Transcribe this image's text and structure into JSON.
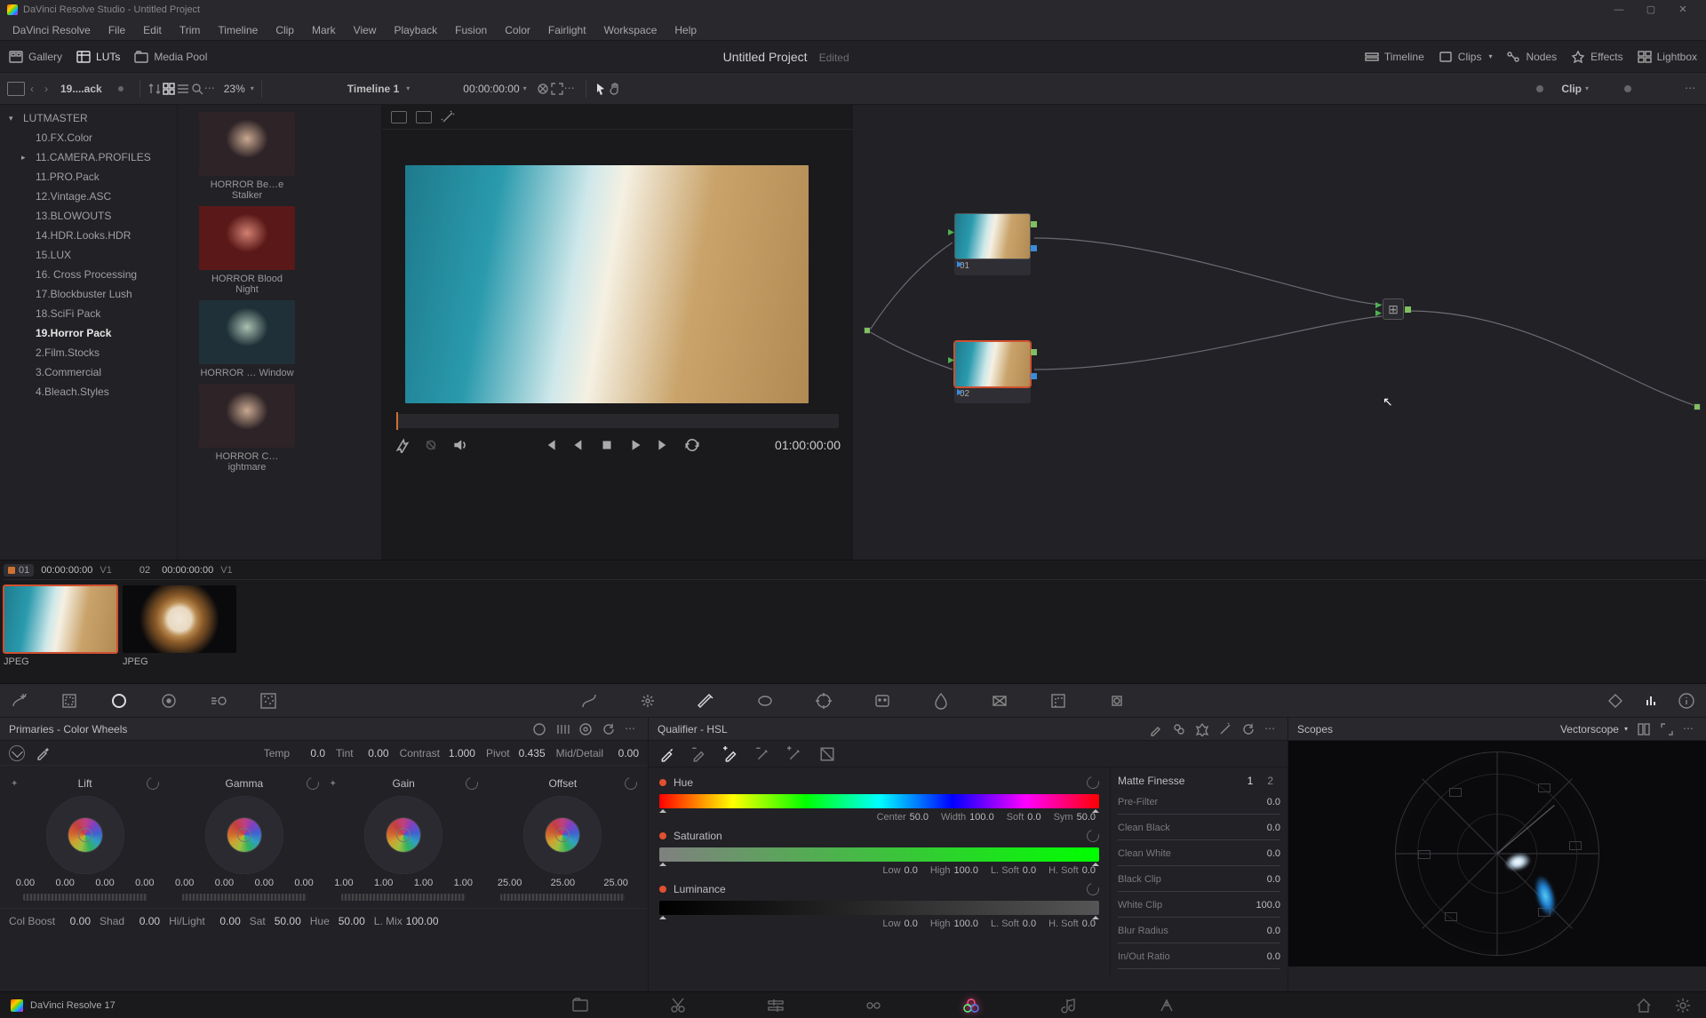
{
  "titlebar": {
    "text": "DaVinci Resolve Studio - Untitled Project"
  },
  "menu": [
    "DaVinci Resolve",
    "File",
    "Edit",
    "Trim",
    "Timeline",
    "Clip",
    "Mark",
    "View",
    "Playback",
    "Fusion",
    "Color",
    "Fairlight",
    "Workspace",
    "Help"
  ],
  "toptoolbar": {
    "gallery": "Gallery",
    "luts": "LUTs",
    "mediapool": "Media Pool",
    "project": "Untitled Project",
    "edited": "Edited",
    "timeline": "Timeline",
    "clips": "Clips",
    "nodes": "Nodes",
    "effects": "Effects",
    "lightbox": "Lightbox"
  },
  "subheader": {
    "crumb": "19....ack",
    "zoom": "23%",
    "timeline": "Timeline 1",
    "tc_small": "00:00:00:00",
    "clip": "Clip"
  },
  "lut_tree": {
    "root": "LUTMASTER",
    "items": [
      "10.FX.Color",
      "11.CAMERA.PROFILES",
      "11.PRO.Pack",
      "12.Vintage.ASC",
      "13.BLOWOUTS",
      "14.HDR.Looks.HDR",
      "15.LUX",
      "16. Cross Processing",
      "17.Blockbuster Lush",
      "18.SciFi Pack",
      "19.Horror Pack",
      "2.Film.Stocks",
      "3.Commercial",
      "4.Bleach.Styles"
    ],
    "selected_index": 10,
    "collapsed_index": 1
  },
  "lut_thumbs": [
    "HORROR Be…e Stalker",
    "HORROR Blood Night",
    "HORROR … Window",
    "HORROR C…ightmare"
  ],
  "viewer": {
    "tc": "01:00:00:00"
  },
  "nodes": {
    "n1": "01",
    "n2": "02"
  },
  "clips": {
    "h1": {
      "num": "01",
      "tc": "00:00:00:00",
      "track": "V1"
    },
    "h2": {
      "num": "02",
      "tc": "00:00:00:00",
      "track": "V1"
    },
    "label": "JPEG"
  },
  "primaries": {
    "title": "Primaries - Color Wheels",
    "row1": {
      "temp_l": "Temp",
      "temp": "0.0",
      "tint_l": "Tint",
      "tint": "0.00",
      "contrast_l": "Contrast",
      "contrast": "1.000",
      "pivot_l": "Pivot",
      "pivot": "0.435",
      "md_l": "Mid/Detail",
      "md": "0.00"
    },
    "wheels": {
      "lift": {
        "name": "Lift",
        "v": [
          "0.00",
          "0.00",
          "0.00",
          "0.00"
        ]
      },
      "gamma": {
        "name": "Gamma",
        "v": [
          "0.00",
          "0.00",
          "0.00",
          "0.00"
        ]
      },
      "gain": {
        "name": "Gain",
        "v": [
          "1.00",
          "1.00",
          "1.00",
          "1.00"
        ]
      },
      "offset": {
        "name": "Offset",
        "v": [
          "25.00",
          "25.00",
          "25.00"
        ]
      }
    },
    "row2": {
      "cb_l": "Col Boost",
      "cb": "0.00",
      "shad_l": "Shad",
      "shad": "0.00",
      "hl_l": "Hi/Light",
      "hl": "0.00",
      "sat_l": "Sat",
      "sat": "50.00",
      "hue_l": "Hue",
      "hue": "50.00",
      "lm_l": "L. Mix",
      "lm": "100.00"
    }
  },
  "qualifier": {
    "title": "Qualifier - HSL",
    "hue": {
      "name": "Hue",
      "center_l": "Center",
      "center": "50.0",
      "width_l": "Width",
      "width": "100.0",
      "soft_l": "Soft",
      "soft": "0.0",
      "sym_l": "Sym",
      "sym": "50.0"
    },
    "sat": {
      "name": "Saturation",
      "low_l": "Low",
      "low": "0.0",
      "high_l": "High",
      "high": "100.0",
      "ls_l": "L. Soft",
      "ls": "0.0",
      "hs_l": "H. Soft",
      "hs": "0.0"
    },
    "lum": {
      "name": "Luminance",
      "low_l": "Low",
      "low": "0.0",
      "high_l": "High",
      "high": "100.0",
      "ls_l": "L. Soft",
      "ls": "0.0",
      "hs_l": "H. Soft",
      "hs": "0.0"
    },
    "matte": {
      "title": "Matte Finesse",
      "p1": "1",
      "p2": "2",
      "rows": [
        {
          "l": "Pre-Filter",
          "v": "0.0"
        },
        {
          "l": "Clean Black",
          "v": "0.0"
        },
        {
          "l": "Clean White",
          "v": "0.0"
        },
        {
          "l": "Black Clip",
          "v": "0.0"
        },
        {
          "l": "White Clip",
          "v": "100.0"
        },
        {
          "l": "Blur Radius",
          "v": "0.0"
        },
        {
          "l": "In/Out Ratio",
          "v": "0.0"
        }
      ]
    }
  },
  "scopes": {
    "title": "Scopes",
    "type": "Vectorscope"
  },
  "footer": {
    "app": "DaVinci Resolve 17"
  }
}
